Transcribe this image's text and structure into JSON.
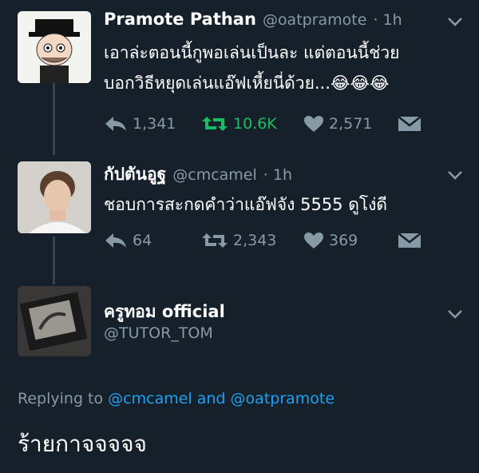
{
  "tweets": [
    {
      "name": "Pramote Pathan",
      "handle": "@oatpramote",
      "time": "· 1h",
      "lines": [
        "เอาล่ะตอนนี้กูพอเล่นเป็นละ แต่ตอนนี้ช่วย",
        "บอกวิธีหยุดเล่นแอ๊ฟเหี้ยนี่ด้วย...😂😂😂"
      ],
      "replies": "1,341",
      "retweets": "10.6K",
      "likes": "2,571"
    },
    {
      "name": "กัปตันอูฐ",
      "handle": "@cmcamel",
      "time": "· 1h",
      "lines": [
        "ชอบการสะกดคำว่าแอ๊ฟจัง 5555 ดูโง่ดี"
      ],
      "replies": "64",
      "retweets": "2,343",
      "likes": "369"
    }
  ],
  "reply_author": {
    "name": "ครูทอม official",
    "handle": "@TUTOR_TOM"
  },
  "replying": {
    "prefix": "Replying to",
    "user1": "@cmcamel",
    "and": "and",
    "user2": "@oatpramote"
  },
  "reply_text": "ร้ายกาจจจจจ",
  "colors": {
    "background": "#15202b",
    "secondary": "#8899a6",
    "retweeted": "#17bf63",
    "link": "#1da1f2"
  }
}
